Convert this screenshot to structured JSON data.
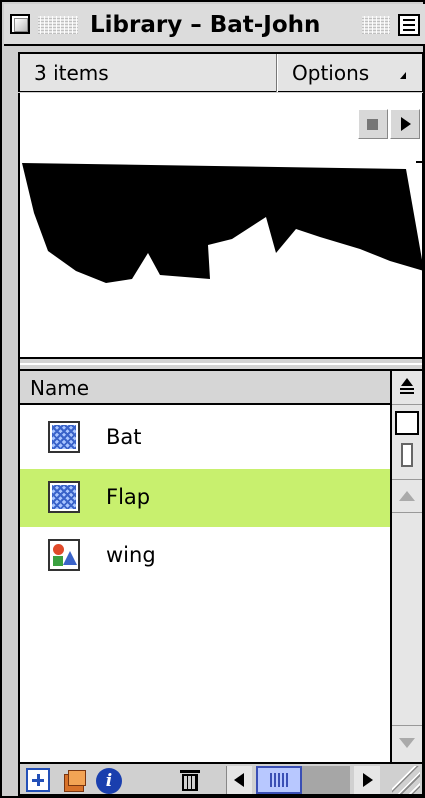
{
  "window": {
    "title": "Library – Bat-John",
    "accent_selected_row": "#c8f06e"
  },
  "header": {
    "item_count": "3 items",
    "options_label": "Options",
    "options_icon": "options-menu-arrow-icon"
  },
  "preview": {
    "controls": [
      "stop-icon",
      "play-icon"
    ]
  },
  "list": {
    "column_header": "Name",
    "items": [
      {
        "label": "Bat",
        "icon": "movie-clip-symbol-icon",
        "selected": false
      },
      {
        "label": "Flap",
        "icon": "movie-clip-symbol-icon",
        "selected": true
      },
      {
        "label": "wing",
        "icon": "graphic-symbol-icon",
        "selected": false
      }
    ]
  },
  "side_controls": [
    "sort-order-icon",
    "wide-view-icon",
    "narrow-view-icon",
    "scroll-up-icon",
    "scroll-down-icon"
  ],
  "bottom_bar": {
    "buttons": [
      "new-symbol-icon",
      "new-folder-icon",
      "properties-icon",
      "delete-icon"
    ],
    "properties_glyph": "i"
  }
}
